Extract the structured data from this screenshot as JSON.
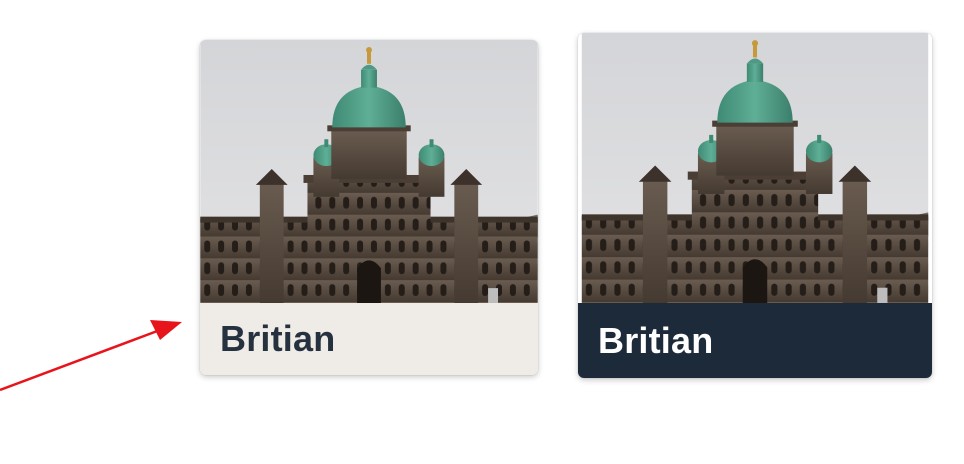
{
  "cards": [
    {
      "label": "Britian",
      "state": "default",
      "caption_bg": "#efebe6",
      "caption_color": "#26313f"
    },
    {
      "label": "Britian",
      "state": "selected",
      "caption_bg": "#1d2a3a",
      "caption_color": "#ffffff"
    }
  ],
  "annotation": {
    "icon": "red-arrow-icon",
    "color": "#e8141c"
  },
  "photo": {
    "subject": "legislature-building-photo",
    "sky_color": "#d9dadd",
    "dome_color": "#4e9a84",
    "stone_color": "#5a4c40"
  }
}
